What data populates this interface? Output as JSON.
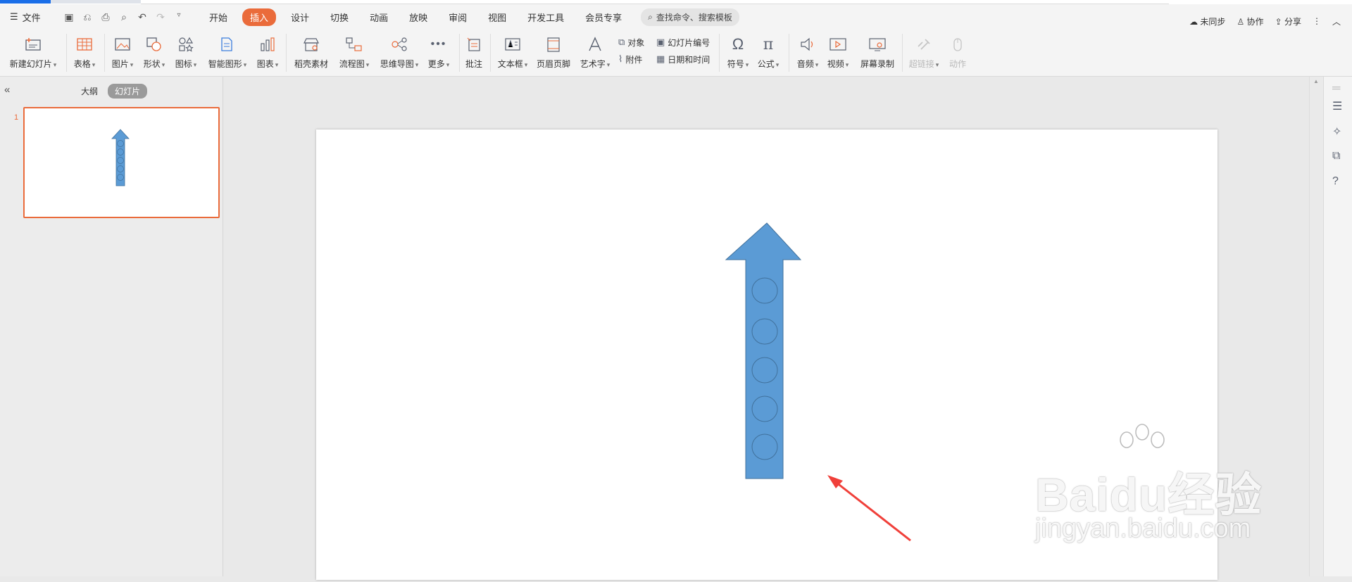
{
  "menubar": {
    "file_label": "文件",
    "tabs": [
      "开始",
      "插入",
      "设计",
      "切换",
      "动画",
      "放映",
      "审阅",
      "视图",
      "开发工具",
      "会员专享"
    ],
    "active_tab": "插入",
    "search_text": "查找命令、搜索模板",
    "right": {
      "sync": "未同步",
      "collab": "协作",
      "share": "分享"
    }
  },
  "ribbon": {
    "new_slide": "新建幻灯片",
    "table": "表格",
    "picture": "图片",
    "shape": "形状",
    "icon": "图标",
    "smart_graphic": "智能图形",
    "chart": "图表",
    "material": "稻壳素材",
    "flowchart": "流程图",
    "mindmap": "思维导图",
    "more": "更多",
    "comment": "批注",
    "textbox": "文本框",
    "header_footer": "页眉页脚",
    "wordart": "艺术字",
    "object": "对象",
    "attachment": "附件",
    "slide_number": "幻灯片编号",
    "datetime": "日期和时间",
    "symbol": "符号",
    "formula": "公式",
    "audio": "音频",
    "video": "视频",
    "screen_record": "屏幕录制",
    "hyperlink": "超链接",
    "action": "动作"
  },
  "left_panel": {
    "outline_tab": "大纲",
    "slides_tab": "幻灯片",
    "slide_number": "1"
  },
  "watermark": {
    "main": "Baidu经验",
    "sub": "jingyan.baidu.com"
  },
  "colors": {
    "accent": "#ea6b3b",
    "arrow_fill": "#5b9bd5",
    "arrow_stroke": "#41719c",
    "pointer": "#f0403a"
  }
}
